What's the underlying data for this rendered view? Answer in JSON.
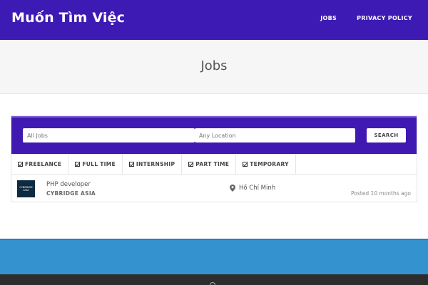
{
  "header": {
    "brand": "Muốn Tìm Việc",
    "nav": [
      "JOBS",
      "PRIVACY POLICY"
    ]
  },
  "page": {
    "title": "Jobs"
  },
  "search": {
    "keywords_placeholder": "All Jobs",
    "location_placeholder": "Any Location",
    "button": "SEARCH"
  },
  "job_types": [
    "FREELANCE",
    "FULL TIME",
    "INTERNSHIP",
    "PART TIME",
    "TEMPORARY"
  ],
  "jobs": [
    {
      "logo_text": "CYBRIDGE ASIA",
      "title": "PHP developer",
      "company": "CYBRIDGE ASIA",
      "location": "Hồ Chí Minh",
      "posted": "Posted 10 months ago"
    }
  ],
  "colors": {
    "header_bg": "#3e1ab4",
    "search_bg": "#3f19b2",
    "footer_blue": "#3492cf",
    "footer_dark": "#2d2d2d"
  }
}
